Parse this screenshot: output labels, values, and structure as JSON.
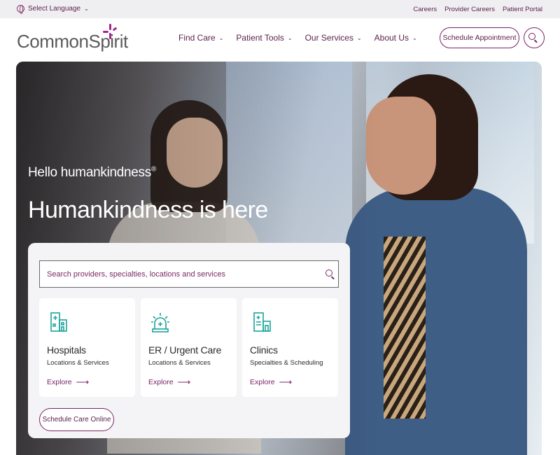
{
  "utility": {
    "language_label": "Select Language",
    "links": [
      "Careers",
      "Provider Careers",
      "Patient Portal"
    ]
  },
  "header": {
    "logo_text": "CommonSpirit",
    "nav": [
      "Find Care",
      "Patient Tools",
      "Our Services",
      "About Us"
    ],
    "schedule_button": "Schedule Appointment"
  },
  "hero": {
    "eyebrow": "Hello humankindness",
    "eyebrow_mark": "®",
    "title": "Humankindness is here"
  },
  "search": {
    "placeholder": "Search providers, specialties, locations and services"
  },
  "cards": [
    {
      "title": "Hospitals",
      "subtitle": "Locations & Services",
      "link": "Explore",
      "icon": "hospital-icon"
    },
    {
      "title": "ER / Urgent Care",
      "subtitle": "Locations & Services",
      "link": "Explore",
      "icon": "emergency-siren-icon"
    },
    {
      "title": "Clinics",
      "subtitle": "Specialties & Scheduling",
      "link": "Explore",
      "icon": "clinic-building-icon"
    }
  ],
  "care_button": "Schedule Care Online",
  "colors": {
    "brand_plum": "#7a2467",
    "brand_magenta": "#a3238e",
    "icon_teal": "#1aa59a",
    "utility_bg": "#efeff2"
  }
}
